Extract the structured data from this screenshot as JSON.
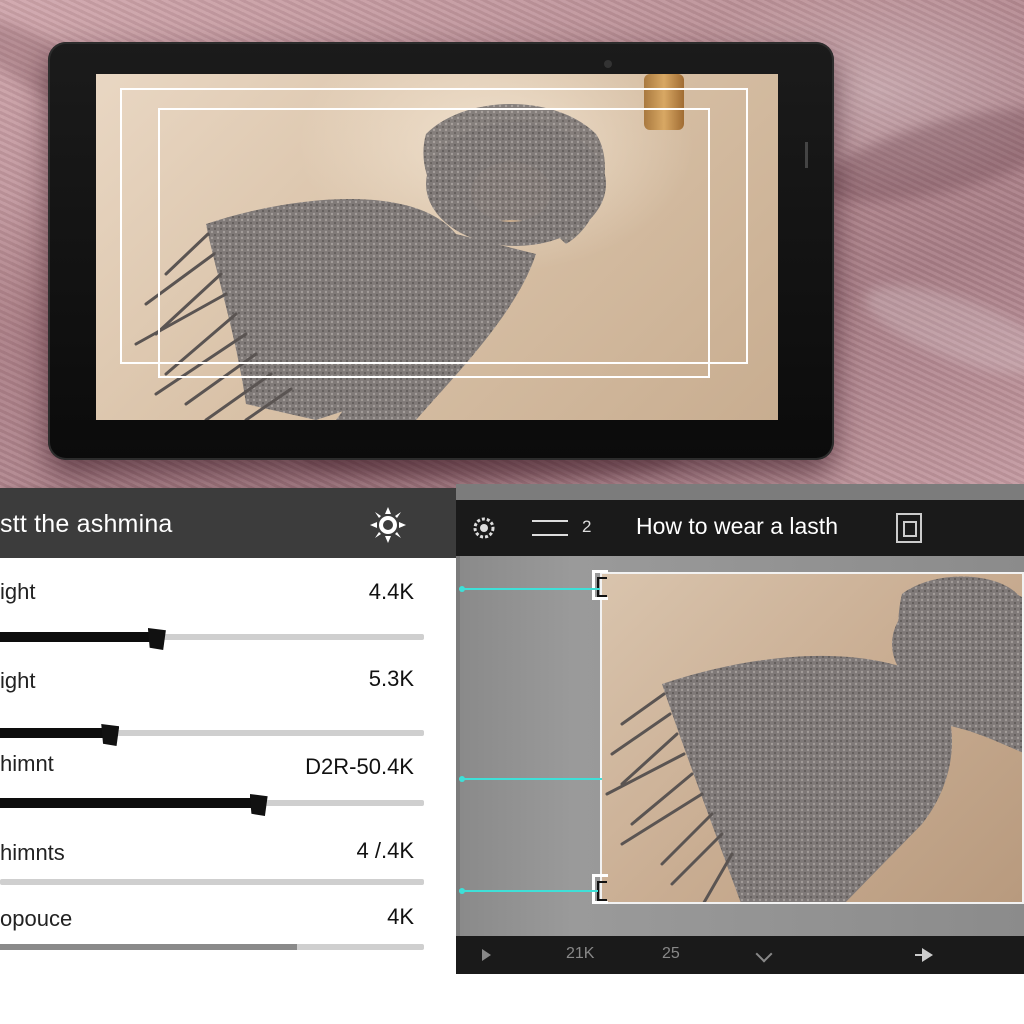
{
  "settings_panel": {
    "title": "stt the ashmina",
    "icon": "sun-gear-icon",
    "rows": [
      {
        "label": "ight",
        "value": "4.4K",
        "level": 0.37
      },
      {
        "label": "ight",
        "value": "5.3K",
        "level": 0.26
      },
      {
        "label": "himnt",
        "value": "D2R-50.4K",
        "level": 0.61
      },
      {
        "label": "himnts",
        "value": "4 /.4K",
        "level": 0.0
      },
      {
        "label": "opouce",
        "value": "4K",
        "level": 0.7
      }
    ]
  },
  "video_panel": {
    "header": {
      "gear_icon": "gear-icon",
      "menu_icon": "menu-icon",
      "count": "2",
      "title": "How to wear a lasth",
      "square_icon": "frame-icon"
    },
    "footer": {
      "play_icon": "play-icon",
      "time_a": "21K",
      "time_b": "25",
      "down_icon": "chevron-down-icon",
      "next_icon": "next-icon"
    },
    "guide_color": "#3ee0d8"
  },
  "colors": {
    "panel_header": "#3c3c3c",
    "video_header": "#1a1a1a",
    "fabric": "#c49aa1",
    "slider_fill": "#0d0d0d"
  }
}
